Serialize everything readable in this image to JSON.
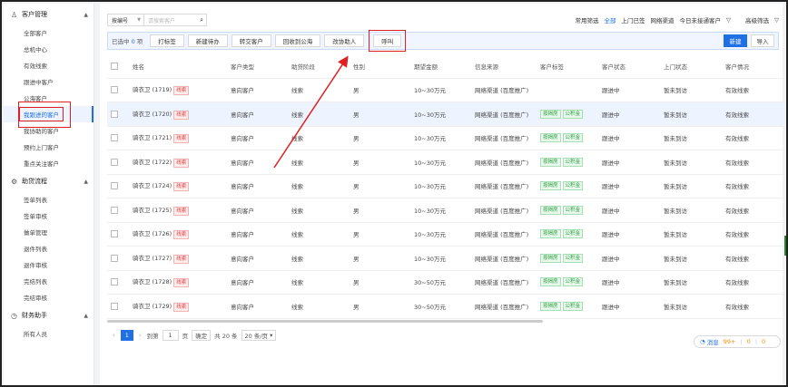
{
  "sidebar": {
    "groups": [
      {
        "label": "客户管理",
        "icon": "user-icon",
        "items": [
          "全部客户",
          "总机中心",
          "有效线索",
          "跟进中客户",
          "公海客户",
          "我跟进的客户",
          "我协助的客户",
          "预约上门客户",
          "重点关注客户"
        ]
      },
      {
        "label": "助贷流程",
        "icon": "flow-icon",
        "items": [
          "签单列表",
          "签单审核",
          "做单管理",
          "退件列表",
          "退件审核",
          "完结列表",
          "完结审核"
        ]
      },
      {
        "label": "财务助手",
        "icon": "clock-icon",
        "items": [
          "所有人员"
        ]
      }
    ],
    "active_item": "我跟进的客户"
  },
  "toolbar": {
    "search_type": "按编号",
    "search_placeholder": "请搜索客户",
    "filters": [
      "常用筛选",
      "全部",
      "上门已签",
      "网络渠道",
      "今日未接通客户"
    ],
    "filter_active": "全部",
    "advanced_filter": "高级筛选"
  },
  "actionbar": {
    "selected_prefix": "已选中",
    "selected_count": "0",
    "selected_suffix": "项",
    "buttons": [
      "打标签",
      "新建待办",
      "转交客户",
      "回收到公海",
      "改协助人",
      "呼叫"
    ],
    "highlighted_button": "呼叫",
    "new_label": "新建",
    "import_label": "导入"
  },
  "table": {
    "headers": [
      "姓名",
      "客户类型",
      "助贷阶段",
      "性别",
      "期望金额",
      "信息来源",
      "客户标签",
      "客户状态",
      "上门状态",
      "客户情况"
    ],
    "rows": [
      {
        "name": "骑衣卫 (1719)",
        "tag": "线索",
        "type": "意向客户",
        "stage": "线索",
        "gender": "男",
        "amount": "10~30万元",
        "source": "网络渠道 (百度推广)",
        "labels": [],
        "status": "跟进中",
        "visit": "暂未到访",
        "situation": "有效线索"
      },
      {
        "name": "骑衣卫 (1720)",
        "tag": "线索",
        "type": "意向客户",
        "stage": "线索",
        "gender": "男",
        "amount": "10~30万元",
        "source": "网络渠道 (百度推广)",
        "labels": [
          "按揭房",
          "公积金"
        ],
        "status": "跟进中",
        "visit": "暂未到访",
        "situation": "有效线索"
      },
      {
        "name": "骑衣卫 (1721)",
        "tag": "线索",
        "type": "意向客户",
        "stage": "线索",
        "gender": "男",
        "amount": "10~30万元",
        "source": "网络渠道 (百度推广)",
        "labels": [
          "按揭房",
          "公积金"
        ],
        "status": "跟进中",
        "visit": "暂未到访",
        "situation": "有效线索"
      },
      {
        "name": "骑衣卫 (1722)",
        "tag": "线索",
        "type": "意向客户",
        "stage": "线索",
        "gender": "男",
        "amount": "10~30万元",
        "source": "网络渠道 (百度推广)",
        "labels": [
          "按揭房",
          "公积金"
        ],
        "status": "跟进中",
        "visit": "暂未到访",
        "situation": "有效线索"
      },
      {
        "name": "骑衣卫 (1724)",
        "tag": "线索",
        "type": "意向客户",
        "stage": "线索",
        "gender": "男",
        "amount": "10~30万元",
        "source": "网络渠道 (百度推广)",
        "labels": [
          "按揭房",
          "公积金"
        ],
        "status": "跟进中",
        "visit": "暂未到访",
        "situation": "有效线索"
      },
      {
        "name": "骑衣卫 (1725)",
        "tag": "线索",
        "type": "意向客户",
        "stage": "线索",
        "gender": "男",
        "amount": "10~30万元",
        "source": "网络渠道 (百度推广)",
        "labels": [
          "按揭房",
          "公积金"
        ],
        "status": "跟进中",
        "visit": "暂未到访",
        "situation": "有效线索"
      },
      {
        "name": "骑衣卫 (1726)",
        "tag": "线索",
        "type": "意向客户",
        "stage": "线索",
        "gender": "男",
        "amount": "10~30万元",
        "source": "网络渠道 (百度推广)",
        "labels": [
          "按揭房",
          "公积金"
        ],
        "status": "跟进中",
        "visit": "暂未到访",
        "situation": "有效线索"
      },
      {
        "name": "骑衣卫 (1727)",
        "tag": "线索",
        "type": "意向客户",
        "stage": "线索",
        "gender": "男",
        "amount": "10~30万元",
        "source": "网络渠道 (百度推广)",
        "labels": [
          "按揭房",
          "公积金"
        ],
        "status": "跟进中",
        "visit": "暂未到访",
        "situation": "有效线索"
      },
      {
        "name": "骑衣卫 (1728)",
        "tag": "线索",
        "type": "意向客户",
        "stage": "线索",
        "gender": "男",
        "amount": "30~50万元",
        "source": "网络渠道 (百度推广)",
        "labels": [
          "按揭房",
          "公积金"
        ],
        "status": "跟进中",
        "visit": "暂未到访",
        "situation": "有效线索"
      },
      {
        "name": "骑衣卫 (1729)",
        "tag": "线索",
        "type": "意向客户",
        "stage": "线索",
        "gender": "男",
        "amount": "30~50万元",
        "source": "网络渠道 (百度推广)",
        "labels": [
          "按揭房",
          "公积金"
        ],
        "status": "跟进中",
        "visit": "暂未到访",
        "situation": "有效线索"
      }
    ]
  },
  "pager": {
    "current": "1",
    "goto_label": "到第",
    "goto_value": "1",
    "page_suffix": "页",
    "confirm_label": "确定",
    "total_label": "共 20 条",
    "size_label": "20 条/页"
  },
  "messages": {
    "label": "消息",
    "count_a": "99+",
    "count_b": "0",
    "count_c": "0"
  },
  "colors": {
    "accent": "#1f6fe5",
    "highlight": "#e02020"
  }
}
